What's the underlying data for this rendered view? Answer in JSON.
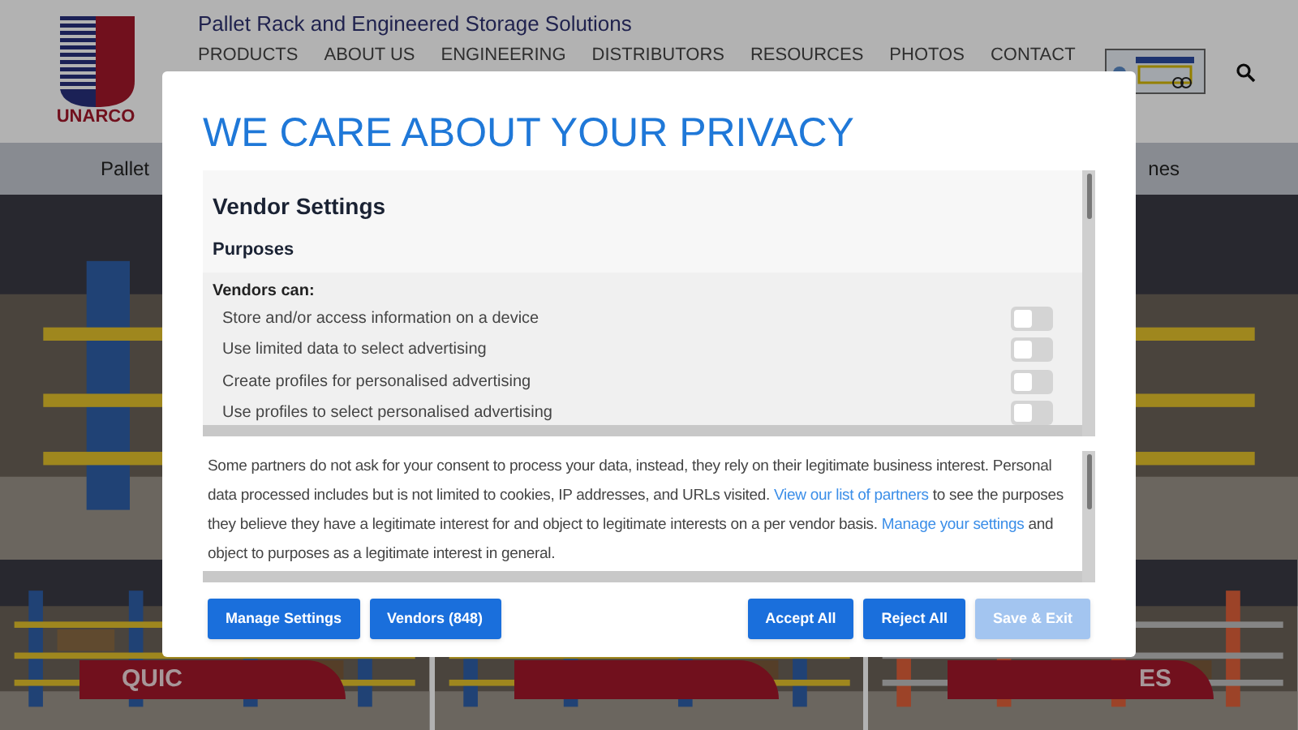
{
  "header": {
    "logo_text": "UNARCO",
    "tagline": "Pallet Rack and Engineered Storage Solutions",
    "nav": [
      "PRODUCTS",
      "ABOUT US",
      "ENGINEERING",
      "DISTRIBUTORS",
      "RESOURCES",
      "PHOTOS",
      "CONTACT"
    ]
  },
  "subnav": [
    "Pallet",
    "nes"
  ],
  "tile_labels": {
    "left": "QUIC",
    "right": "ES"
  },
  "dialog": {
    "title": "WE CARE ABOUT YOUR PRIVACY",
    "vendor_settings": {
      "heading": "Vendor Settings",
      "section": "Purposes",
      "subheading": "Vendors can:",
      "purposes": [
        {
          "label": "Store and/or access information on a device",
          "on": false
        },
        {
          "label": "Use limited data to select advertising",
          "on": false
        },
        {
          "label": "Create profiles for personalised advertising",
          "on": false
        },
        {
          "label": "Use profiles to select personalised advertising",
          "on": false
        }
      ]
    },
    "notice": {
      "text_1": "Some partners do not ask for your consent to process your data, instead, they rely on their legitimate business interest. Personal data processed includes but is not limited to cookies, IP addresses, and URLs visited.",
      "link_1": "View our list of partners",
      "text_2": "to see the purposes they believe they have a legitimate interest for and object to legitimate interests on a per vendor basis.",
      "link_2": "Manage your settings",
      "text_3": "and object to purposes as a legitimate interest in general."
    },
    "buttons_left": [
      {
        "label": "Manage Settings",
        "disabled": false
      },
      {
        "label": "Vendors (848)",
        "disabled": false
      }
    ],
    "buttons_right": [
      {
        "label": "Accept All",
        "disabled": false
      },
      {
        "label": "Reject All",
        "disabled": false
      },
      {
        "label": "Save & Exit",
        "disabled": true
      }
    ]
  }
}
